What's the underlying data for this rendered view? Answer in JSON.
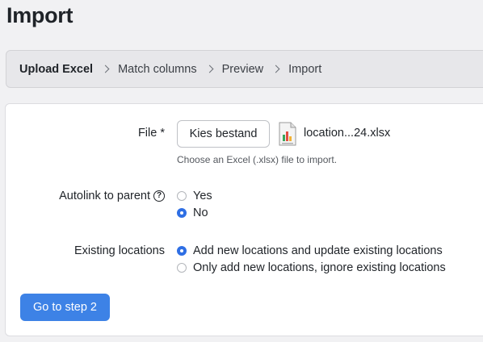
{
  "page": {
    "title": "Import"
  },
  "steps": [
    {
      "label": "Upload Excel",
      "active": true
    },
    {
      "label": "Match columns",
      "active": false
    },
    {
      "label": "Preview",
      "active": false
    },
    {
      "label": "Import",
      "active": false
    }
  ],
  "form": {
    "file": {
      "label": "File *",
      "button_label": "Kies bestand",
      "file_name": "location...24.xlsx",
      "hint": "Choose an Excel (.xlsx) file to import.",
      "file_icon": "excel-file-icon"
    },
    "autolink": {
      "label": "Autolink to parent",
      "help_icon": "question-circle-icon",
      "help_glyph": "?",
      "options": [
        {
          "label": "Yes",
          "checked": false
        },
        {
          "label": "No",
          "checked": true
        }
      ]
    },
    "existing": {
      "label": "Existing locations",
      "options": [
        {
          "label": "Add new locations and update existing locations",
          "checked": true
        },
        {
          "label": "Only add new locations, ignore existing locations",
          "checked": false
        }
      ]
    },
    "submit_label": "Go to step 2"
  },
  "colors": {
    "primary": "#3d82e6",
    "radio_checked": "#2f6fe4",
    "background": "#f1f1f3"
  }
}
